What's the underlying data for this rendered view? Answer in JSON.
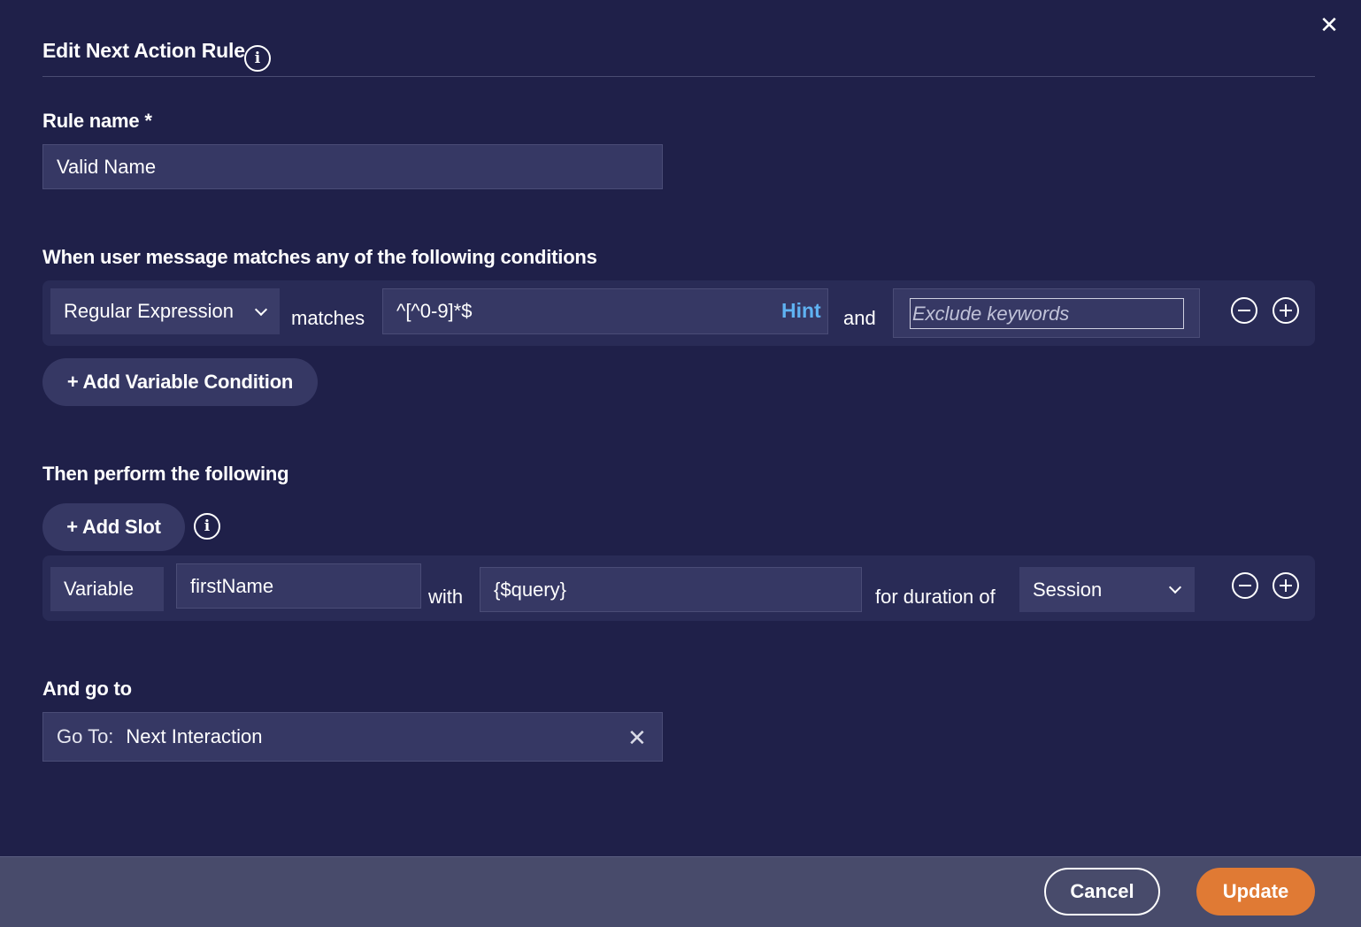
{
  "dialog": {
    "title": "Edit Next Action Rule",
    "title_info_icon": "info-circle-icon",
    "close_icon": "close-icon",
    "close_glyph": "✕"
  },
  "rule_name": {
    "label": "Rule name *",
    "value": "Valid Name"
  },
  "conditions": {
    "label": "When user message matches any of the following conditions",
    "type_select": "Regular Expression",
    "matches_text": "matches",
    "pattern_value": "^[^0-9]*$",
    "hint_label": "Hint",
    "and_text": "and",
    "exclude_placeholder": "Exclude keywords",
    "add_variable_condition": "+ Add Variable Condition"
  },
  "actions": {
    "label": "Then perform the following",
    "add_slot": "+ Add Slot",
    "slot": {
      "type": "Variable",
      "name_value": "firstName",
      "with_text": "with",
      "value": "{$query}",
      "duration_text": "for duration of",
      "duration_select": "Session"
    }
  },
  "go_to": {
    "label": "And go to",
    "prefix": "Go To:",
    "value": "Next Interaction",
    "clear_glyph": "✕"
  },
  "footer": {
    "cancel_label": "Cancel",
    "update_label": "Update"
  },
  "colors": {
    "background": "#1f2049",
    "panel": "#292b56",
    "field": "#363864",
    "hint": "#5fb2f2",
    "footer": "#484b6b",
    "primary_button": "#e07a34"
  }
}
